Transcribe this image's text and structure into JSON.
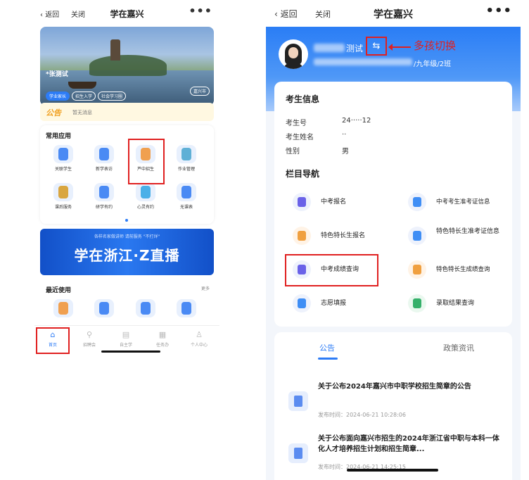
{
  "left": {
    "nav": {
      "back": "返回",
      "close": "关闭",
      "title": "学在嘉兴",
      "more": "•••"
    },
    "banner": {
      "user": "*张测试",
      "chips": [
        "学业家长",
        "招生入学",
        "社会学习圈"
      ],
      "city": "嘉兴市"
    },
    "notice": {
      "tag": "公告",
      "text": "暂无消息"
    },
    "apps": {
      "title": "常用应用",
      "items": [
        "关联学生",
        "新学表访",
        "芦中招生",
        "作业管理",
        "课后服务",
        "研学有约",
        "心灵有约",
        "无课表"
      ]
    },
    "live": {
      "small": "各样名家做讲师  请前服务 \"不打烊\"",
      "big": "学在浙江·Z直播"
    },
    "recent": {
      "title": "最近使用",
      "more": "更多"
    },
    "tabbar": [
      "首页",
      "招聘会",
      "自主学",
      "任务办",
      "个人中心"
    ]
  },
  "right": {
    "nav": {
      "back": "返回",
      "close": "关闭",
      "title": "学在嘉兴",
      "more": "•••"
    },
    "profile": {
      "name": "测试",
      "class": "/九年级/2班",
      "switch_label": "多孩切换"
    },
    "exam": {
      "title": "考生信息",
      "fields": [
        {
          "k": "考生号",
          "v": "24·····12"
        },
        {
          "k": "考生姓名",
          "v": "··"
        },
        {
          "k": "性别",
          "v": "男"
        }
      ]
    },
    "columns": {
      "title": "栏目导航",
      "items": [
        "中考报名",
        "中考考生准考证信息",
        "特色特长生报名",
        "特色特长生准考证信息",
        "中考成绩查询",
        "特色特长生成绩查询",
        "志愿填报",
        "录取结果查询"
      ]
    },
    "news": {
      "tabs": [
        "公告",
        "政策资讯"
      ],
      "items": [
        {
          "title": "关于公布2024年嘉兴市中职学校招生简章的公告",
          "time": "发布时间：2024-06-21 10:28:06"
        },
        {
          "title": "关于公布面向嘉兴市招生的2024年浙江省中职与本科一体化人才培养招生计划和招生简章...",
          "time": "发布时间：2024-06-21 14:25:15"
        }
      ]
    }
  }
}
